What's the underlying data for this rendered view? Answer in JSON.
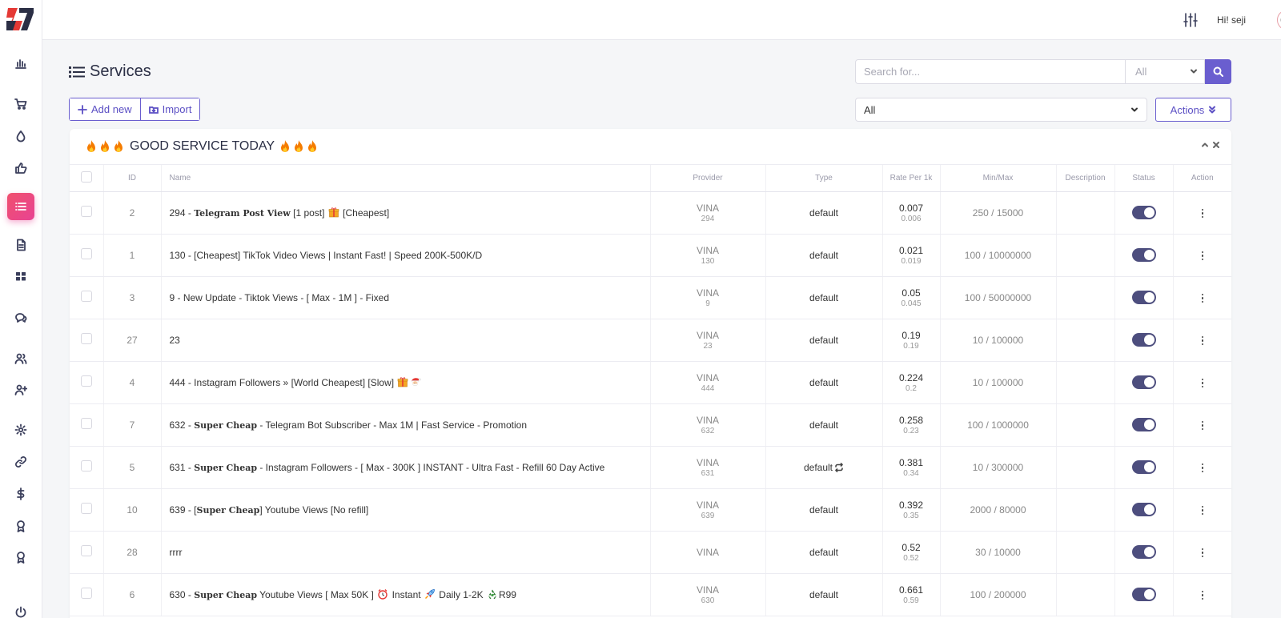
{
  "topbar": {
    "greeting": "Hi! seji"
  },
  "page": {
    "title": "Services"
  },
  "toolbar": {
    "add_label": "Add new",
    "import_label": "Import",
    "actions_label": "Actions"
  },
  "search": {
    "placeholder": "Search for...",
    "scope_value": "All"
  },
  "category_filter": {
    "value": "All"
  },
  "category": {
    "title": "GOOD SERVICE TODAY"
  },
  "table": {
    "headers": [
      "ID",
      "Name",
      "Provider",
      "Type",
      "Rate Per 1k",
      "Min/Max",
      "Description",
      "Status",
      "Action"
    ],
    "rows": [
      {
        "id": "2",
        "name_prefix": "294 - ",
        "name_bold": "Telegram Post View",
        "name_rest": " [1 post] ",
        "name_tail": " [Cheapest]",
        "provider": "VINA",
        "provider_id": "294",
        "type": "default",
        "rate": "0.007",
        "rate_orig": "0.006",
        "minmax": "250 / 15000"
      },
      {
        "id": "1",
        "name_prefix": "130 - [Cheapest] TikTok Video Views | Instant Fast! | Speed 200K-500K/D",
        "name_bold": "",
        "name_rest": "",
        "name_tail": "",
        "provider": "VINA",
        "provider_id": "130",
        "type": "default",
        "rate": "0.021",
        "rate_orig": "0.019",
        "minmax": "100 / 10000000"
      },
      {
        "id": "3",
        "name_prefix": "9 - New Update - Tiktok Views - [ Max - 1M ] - Fixed",
        "name_bold": "",
        "name_rest": "",
        "name_tail": "",
        "provider": "VINA",
        "provider_id": "9",
        "type": "default",
        "rate": "0.05",
        "rate_orig": "0.045",
        "minmax": "100 / 50000000"
      },
      {
        "id": "27",
        "name_prefix": "23",
        "name_bold": "",
        "name_rest": "",
        "name_tail": "",
        "provider": "VINA",
        "provider_id": "23",
        "type": "default",
        "rate": "0.19",
        "rate_orig": "0.19",
        "minmax": "10 / 100000"
      },
      {
        "id": "4",
        "name_prefix": "444 - Instagram Followers » [World Cheapest] [Slow] ",
        "name_bold": "",
        "name_rest": "",
        "name_tail": "",
        "provider": "VINA",
        "provider_id": "444",
        "type": "default",
        "rate": "0.224",
        "rate_orig": "0.2",
        "minmax": "10 / 100000"
      },
      {
        "id": "7",
        "name_prefix": "632 - ",
        "name_bold": "Super Cheap",
        "name_rest": " - Telegram Bot Subscriber - Max 1M | Fast Service - Promotion",
        "name_tail": "",
        "provider": "VINA",
        "provider_id": "632",
        "type": "default",
        "rate": "0.258",
        "rate_orig": "0.23",
        "minmax": "100 / 1000000"
      },
      {
        "id": "5",
        "name_prefix": "631 - ",
        "name_bold": "Super Cheap",
        "name_rest": " - Instagram Followers - [ Max - 300K ] INSTANT - Ultra Fast - Refill 60 Day Active",
        "name_tail": "",
        "provider": "VINA",
        "provider_id": "631",
        "type": "default",
        "rate": "0.381",
        "rate_orig": "0.34",
        "minmax": "10 / 300000"
      },
      {
        "id": "10",
        "name_prefix": "639 - [",
        "name_bold": "Super Cheap",
        "name_rest": "] Youtube Views [No refill]",
        "name_tail": "",
        "provider": "VINA",
        "provider_id": "639",
        "type": "default",
        "rate": "0.392",
        "rate_orig": "0.35",
        "minmax": "2000 / 80000"
      },
      {
        "id": "28",
        "name_prefix": "rrrr",
        "name_bold": "",
        "name_rest": "",
        "name_tail": "",
        "provider": "VINA",
        "provider_id": "",
        "type": "default",
        "rate": "0.52",
        "rate_orig": "0.52",
        "minmax": "30 / 10000"
      },
      {
        "id": "6",
        "name_prefix": "630 - ",
        "name_bold": "Super Cheap",
        "name_rest": " Youtube Views [ Max 50K ] ",
        "name_tail": " Instant ",
        "name_tail2": " Daily 1-2K ",
        "name_tail3": "R99",
        "provider": "VINA",
        "provider_id": "630",
        "type": "default",
        "rate": "0.661",
        "rate_orig": "0.59",
        "minmax": "100 / 200000"
      }
    ]
  },
  "colors": {
    "accent": "#6a5ecf",
    "active_nav": "#e84393",
    "toggle": "#4d4e7e"
  }
}
